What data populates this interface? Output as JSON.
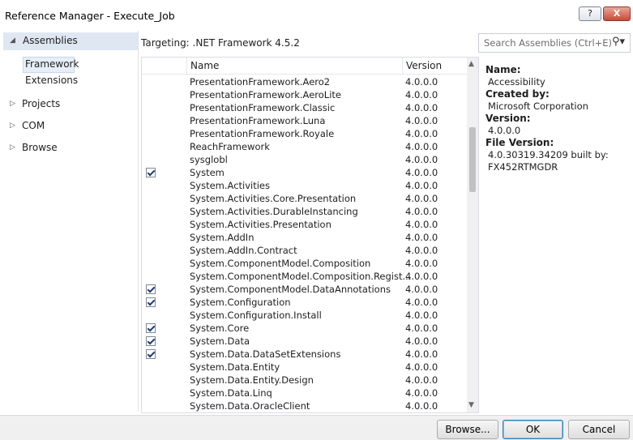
{
  "window": {
    "title": "Reference Manager - Execute_Job",
    "help_label": "?",
    "close_label": "X"
  },
  "nav": {
    "assemblies_label": "Assemblies",
    "framework_label": "Framework",
    "extensions_label": "Extensions",
    "projects_label": "Projects",
    "com_label": "COM",
    "browse_label": "Browse"
  },
  "targeting": "Targeting: .NET Framework 4.5.2",
  "search": {
    "placeholder": "Search Assemblies (Ctrl+E)"
  },
  "grid": {
    "headers": {
      "name": "Name",
      "version": "Version"
    },
    "rows": [
      {
        "name": "PresentationFramework.Aero2",
        "version": "4.0.0.0",
        "checked": false
      },
      {
        "name": "PresentationFramework.AeroLite",
        "version": "4.0.0.0",
        "checked": false
      },
      {
        "name": "PresentationFramework.Classic",
        "version": "4.0.0.0",
        "checked": false
      },
      {
        "name": "PresentationFramework.Luna",
        "version": "4.0.0.0",
        "checked": false
      },
      {
        "name": "PresentationFramework.Royale",
        "version": "4.0.0.0",
        "checked": false
      },
      {
        "name": "ReachFramework",
        "version": "4.0.0.0",
        "checked": false
      },
      {
        "name": "sysglobl",
        "version": "4.0.0.0",
        "checked": false
      },
      {
        "name": "System",
        "version": "4.0.0.0",
        "checked": true
      },
      {
        "name": "System.Activities",
        "version": "4.0.0.0",
        "checked": false
      },
      {
        "name": "System.Activities.Core.Presentation",
        "version": "4.0.0.0",
        "checked": false
      },
      {
        "name": "System.Activities.DurableInstancing",
        "version": "4.0.0.0",
        "checked": false
      },
      {
        "name": "System.Activities.Presentation",
        "version": "4.0.0.0",
        "checked": false
      },
      {
        "name": "System.AddIn",
        "version": "4.0.0.0",
        "checked": false
      },
      {
        "name": "System.AddIn.Contract",
        "version": "4.0.0.0",
        "checked": false
      },
      {
        "name": "System.ComponentModel.Composition",
        "version": "4.0.0.0",
        "checked": false
      },
      {
        "name": "System.ComponentModel.Composition.Regist...",
        "version": "4.0.0.0",
        "checked": false
      },
      {
        "name": "System.ComponentModel.DataAnnotations",
        "version": "4.0.0.0",
        "checked": true
      },
      {
        "name": "System.Configuration",
        "version": "4.0.0.0",
        "checked": true
      },
      {
        "name": "System.Configuration.Install",
        "version": "4.0.0.0",
        "checked": false
      },
      {
        "name": "System.Core",
        "version": "4.0.0.0",
        "checked": true
      },
      {
        "name": "System.Data",
        "version": "4.0.0.0",
        "checked": true
      },
      {
        "name": "System.Data.DataSetExtensions",
        "version": "4.0.0.0",
        "checked": true
      },
      {
        "name": "System.Data.Entity",
        "version": "4.0.0.0",
        "checked": false
      },
      {
        "name": "System.Data.Entity.Design",
        "version": "4.0.0.0",
        "checked": false
      },
      {
        "name": "System.Data.Linq",
        "version": "4.0.0.0",
        "checked": false
      },
      {
        "name": "System.Data.OracleClient",
        "version": "4.0.0.0",
        "checked": false
      }
    ]
  },
  "details": {
    "name_label": "Name:",
    "name_value": "Accessibility",
    "created_label": "Created by:",
    "created_value": "Microsoft Corporation",
    "version_label": "Version:",
    "version_value": "4.0.0.0",
    "file_version_label": "File Version:",
    "file_version_value": "4.0.30319.34209 built by:",
    "file_version_value2": "FX452RTMGDR"
  },
  "buttons": {
    "browse": "Browse...",
    "ok": "OK",
    "cancel": "Cancel"
  }
}
